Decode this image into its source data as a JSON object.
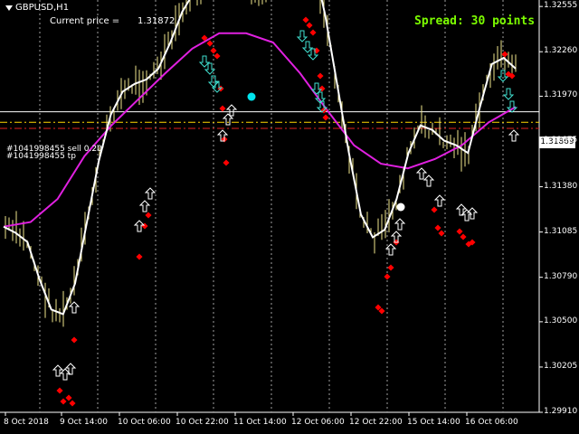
{
  "header": {
    "symbol": "GBPUSD,H1",
    "current_price_label": "Current price  =",
    "current_price_value": "1.31872",
    "spread_text": "Spread: 30 points"
  },
  "orders": {
    "line1": "#1041998455 sell 0.20",
    "line2": "#1041998455 tp"
  },
  "price_tag": "1.31869",
  "price_axis": [
    "1.32555",
    "1.32260",
    "1.31970",
    "1.31675",
    "1.31380",
    "1.31085",
    "1.30790",
    "1.30500",
    "1.30205",
    "1.29910"
  ],
  "time_axis": [
    "8 Oct 2018",
    "9 Oct 14:00",
    "10 Oct 06:00",
    "10 Oct 22:00",
    "11 Oct 14:00",
    "12 Oct 06:00",
    "12 Oct 22:00",
    "15 Oct 14:00",
    "16 Oct 06:00"
  ],
  "colors": {
    "spread": "#7cfc00",
    "candles": "#f0e68c",
    "smooth_line": "#ffffff",
    "ma_line": "#e020e0",
    "sell_level": "#ffd700",
    "tp_level": "#e02020",
    "dots": "#ff0000",
    "up_arrow": "#ffffff",
    "down_arrow": "#40e0d0",
    "grid": "#a0a0a0"
  },
  "chart_data": {
    "type": "line",
    "series": [
      {
        "name": "",
        "values": [
          1.3112,
          1.3108,
          1.3102,
          1.3078,
          1.3058,
          1.3055,
          1.3075,
          1.3115,
          1.3155,
          1.3185,
          1.32,
          1.3205,
          1.3208,
          1.3215,
          1.3232,
          1.3252,
          1.3265,
          1.3272,
          1.3275,
          1.327,
          1.3265,
          1.3262,
          1.3268,
          1.3282,
          1.329,
          1.3292,
          1.3285,
          1.325,
          1.3205,
          1.316,
          1.312,
          1.3105,
          1.311,
          1.313,
          1.316,
          1.3178,
          1.3175,
          1.3168,
          1.3165,
          1.316,
          1.319,
          1.3218,
          1.3222,
          1.3215
        ]
      },
      {
        "name": "",
        "values": [
          1.3112,
          1.3115,
          1.313,
          1.3158,
          1.3178,
          1.3195,
          1.3212,
          1.3228,
          1.3238,
          1.3238,
          1.3232,
          1.3212,
          1.3188,
          1.3165,
          1.3153,
          1.315,
          1.3156,
          1.3165,
          1.318,
          1.319
        ]
      }
    ],
    "levels": [
      1.31869,
      1.318,
      1.3176
    ],
    "ylim": [
      1.2991,
      1.3255
    ]
  }
}
